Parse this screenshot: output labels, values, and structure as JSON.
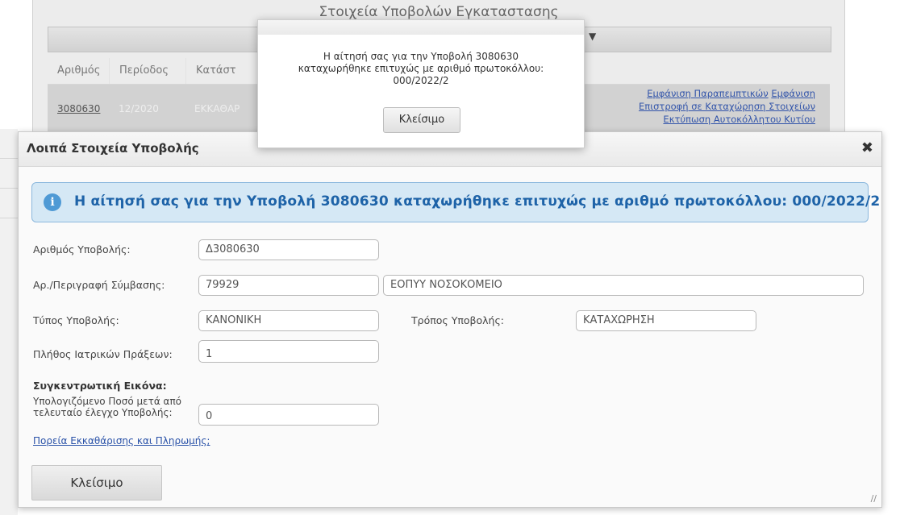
{
  "background": {
    "panel_title": "Στοιχεία Υποβολών Εγκαταστασης",
    "table_headers": [
      "Αριθμός",
      "Περίοδος",
      "Κατάστ"
    ],
    "row": {
      "number": "3080630",
      "period": "12/2020",
      "status": "ΕΚΚΑΘΑΡ"
    },
    "row_links": [
      "Εμφάνιση Παραπεμπτικών",
      "Εμφάνιση",
      "Επιστροφή σε Καταχώρηση Στοιχείων",
      "Εκτύπωση Αυτοκόλλητου Κυτίου"
    ]
  },
  "dialog": {
    "title": "Λοιπά Στοιχεία Υποβολής",
    "close_symbol": "✖",
    "banner_text": "Η αίτησή σας για την Υποβολή 3080630 καταχωρήθηκε επιτυχώς με αριθμό πρωτοκόλλου: 000/2022/2",
    "fields": {
      "submission_number_label": "Αριθμός Υποβολής:",
      "submission_number_value": "Δ3080630",
      "contract_label": "Αρ./Περιγραφή Σύμβασης:",
      "contract_number_value": "79929",
      "contract_description_value": "ΕΟΠΥΥ ΝΟΣΟΚΟΜΕΙΟ",
      "submission_type_label": "Τύπος Υποβολής:",
      "submission_type_value": "ΚΑΝΟΝΙΚΗ",
      "submission_mode_label": "Τρόπος Υποβολής:",
      "submission_mode_value": "ΚΑΤΑΧΩΡΗΣΗ",
      "medical_acts_label": "Πλήθος Ιατρικών Πράξεων:",
      "medical_acts_value": "1"
    },
    "summary_title": "Συγκεντρωτική Εικόνα:",
    "calculated_amount_label_line1": "Υπολογιζόμενο Ποσό μετά από",
    "calculated_amount_label_line2": "τελευταίο έλεγχο Υποβολής:",
    "calculated_amount_value": "0",
    "clearing_link": "Πορεία Εκκαθάρισης και Πληρωμής;",
    "close_button": "Κλείσιμο"
  },
  "popup": {
    "message_line1": "Η αίτησή σας για την Υποβολή 3080630",
    "message_line2": "καταχωρήθηκε επιτυχώς με αριθμό πρωτοκόλλου:",
    "message_line3": "000/2022/2",
    "close_button": "Κλείσιμο"
  }
}
